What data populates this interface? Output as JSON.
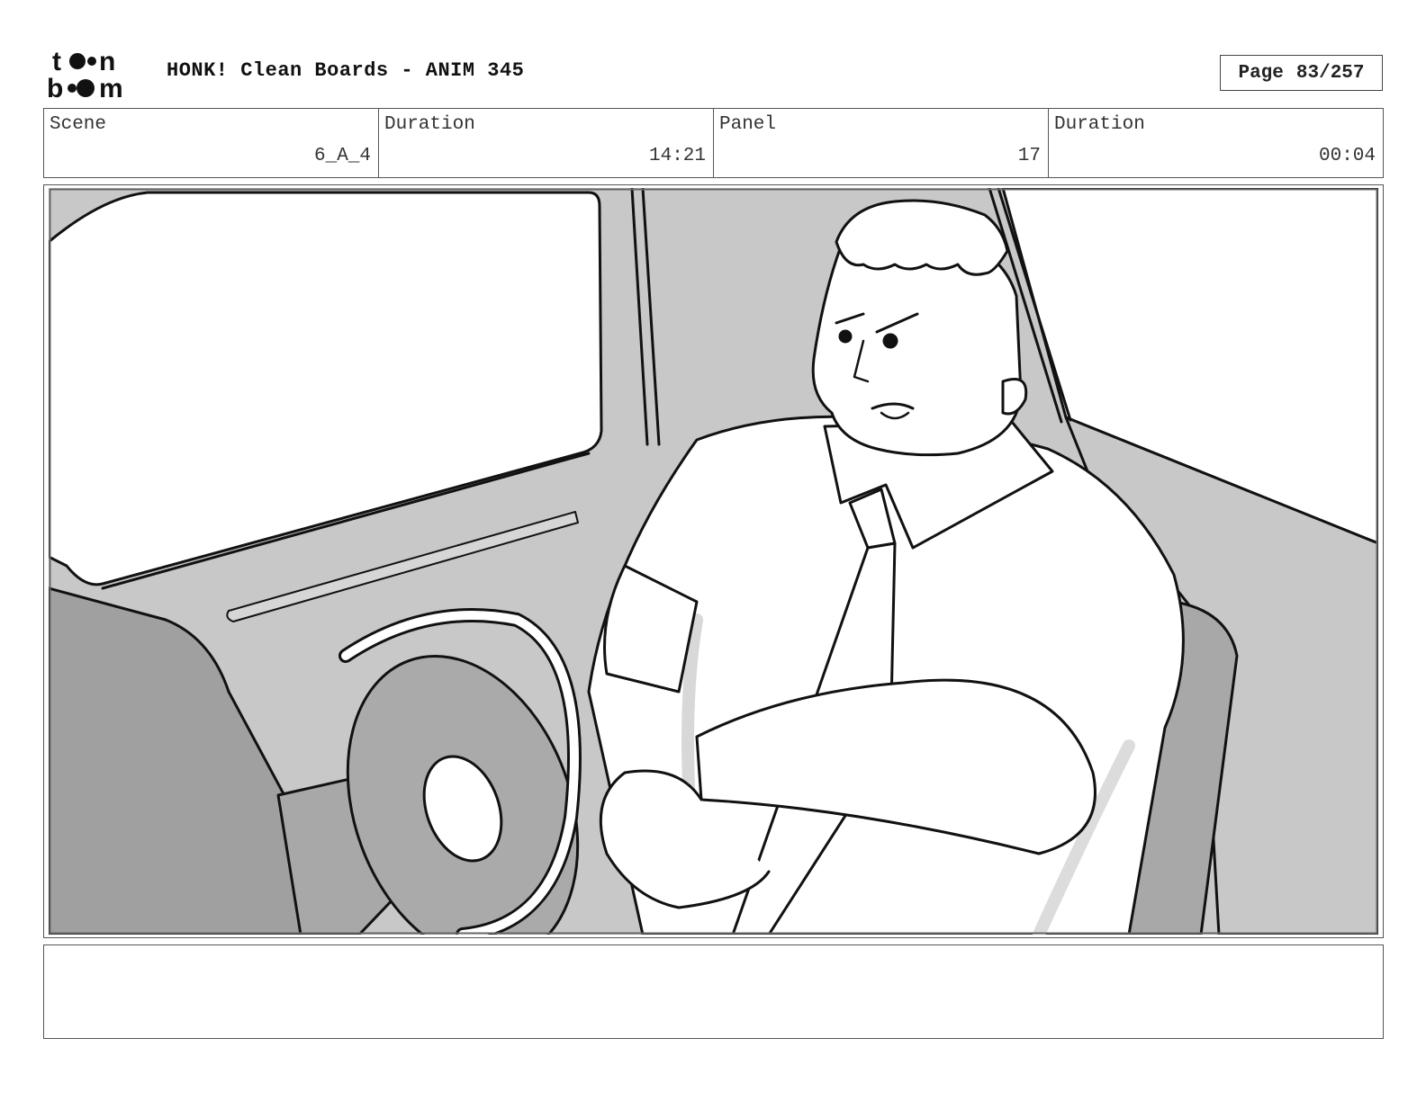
{
  "header": {
    "logo_text": "toonboom",
    "title": "HONK! Clean Boards - ANIM 345",
    "page_label": "Page",
    "page_value": "83/257"
  },
  "info": {
    "scene_label": "Scene",
    "scene_value": "6_A_4",
    "duration1_label": "Duration",
    "duration1_value": "14:21",
    "panel_label": "Panel",
    "panel_value": "17",
    "duration2_label": "Duration",
    "duration2_value": "00:04"
  },
  "notes": {
    "text": ""
  }
}
